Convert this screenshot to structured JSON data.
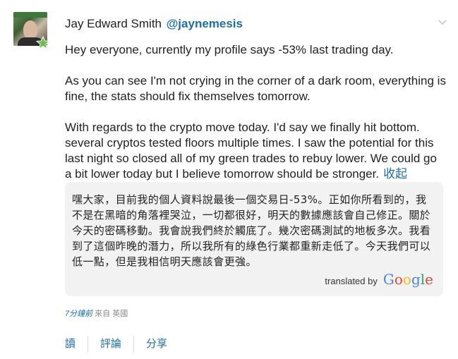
{
  "post": {
    "author_name": "Jay Edward Smith",
    "author_handle": "@jaynemesis",
    "paragraphs": [
      "Hey everyone, currently my profile says -53% last trading day.",
      "As you can see I'm not crying in the corner of a dark room, everything is fine, the stats should fix themselves tomorrow.",
      "With regards to the crypto move today. I'd say we finally hit bottom. several cryptos tested floors multiple times. I saw the potential for this last night so closed all of my green trades to rebuy lower. We could go a bit lower today but I believe tomorrow should be stronger."
    ],
    "collapse_label": "收起"
  },
  "translation": {
    "text": "嘿大家，目前我的個人資料說最後一個交易日-53%。正如你所看到的，我不是在黑暗的角落裡哭泣，一切都很好，明天的數據應該會自己修正。關於今天的密碼移動。我會說我們終於觸底了。幾次密碼測試的地板多次。我看到了這個昨晚的潛力，所以我所有的綠色行業都重新走低了。今天我們可以低一點，但是我相信明天應該會更強。",
    "translated_by": "translated by",
    "provider": "Google"
  },
  "meta": {
    "time": "7分鐘前",
    "source": "來自 英國"
  },
  "actions": {
    "read": "讀",
    "comment": "評論",
    "share": "分享"
  },
  "icons": {
    "badge": "star-icon",
    "menu": "chevron-down-icon"
  },
  "colors": {
    "link": "#1d6fa5",
    "badge": "#6cc04a",
    "translation_bg": "#f2f2f2"
  }
}
